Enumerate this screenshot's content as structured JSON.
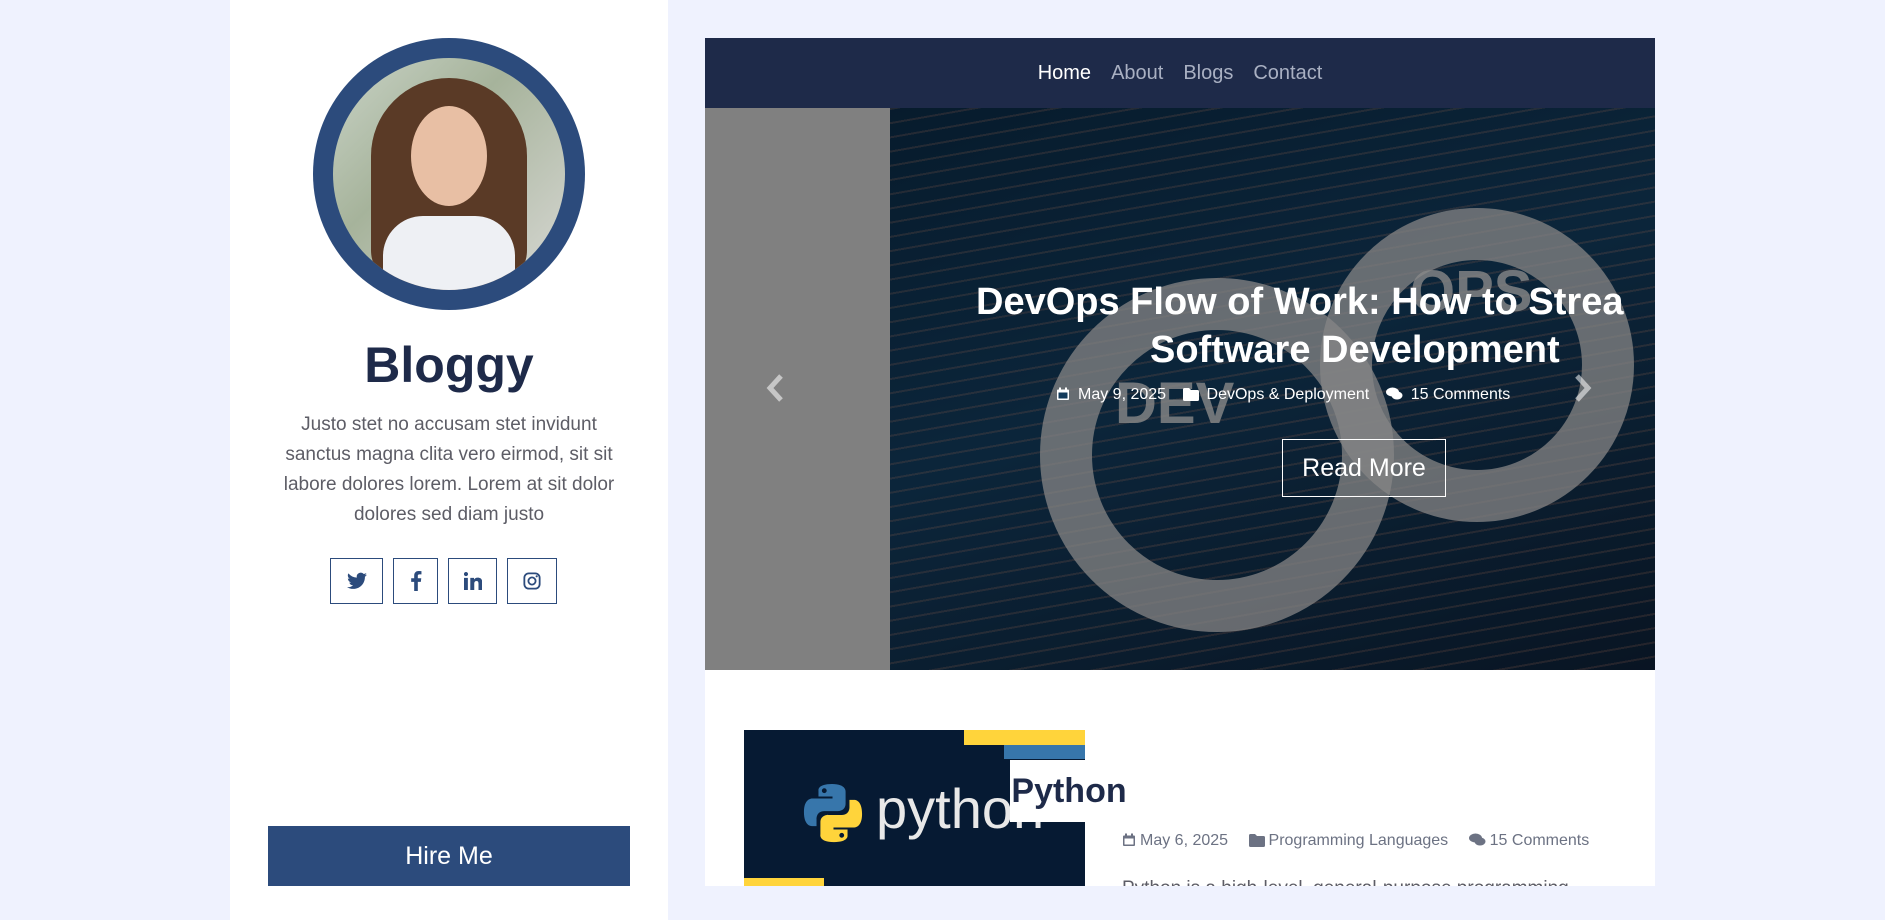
{
  "sidebar": {
    "brand": "Bloggy",
    "bio": "Justo stet no accusam stet invidunt sanctus magna clita vero eirmod, sit sit labore dolores lorem. Lorem at sit dolor dolores sed diam justo",
    "socials": [
      {
        "icon": "twitter-icon"
      },
      {
        "icon": "facebook-icon"
      },
      {
        "icon": "linkedin-icon"
      },
      {
        "icon": "instagram-icon"
      }
    ],
    "hire_label": "Hire Me"
  },
  "nav": {
    "items": [
      "Home",
      "About",
      "Blogs",
      "Contact"
    ],
    "active": "Home"
  },
  "carousel": {
    "title_line1": "DevOps Flow of Work: How to Strea",
    "title_line2": "Software Development",
    "date": "May 9, 2025",
    "category": "DevOps & Deployment",
    "comments": "15 Comments",
    "read_more": "Read More",
    "prev_icon": "chevron-left-icon",
    "next_icon": "chevron-right-icon"
  },
  "post": {
    "thumb_text": "python",
    "title": "Python",
    "date": "May 6, 2025",
    "category": "Programming Languages",
    "comments": "15 Comments",
    "excerpt": "Python is a high-level, general-purpose programming"
  },
  "colors": {
    "page_bg": "#eff2fe",
    "navy": "#1e2a49",
    "accent": "#2c4b7c"
  }
}
